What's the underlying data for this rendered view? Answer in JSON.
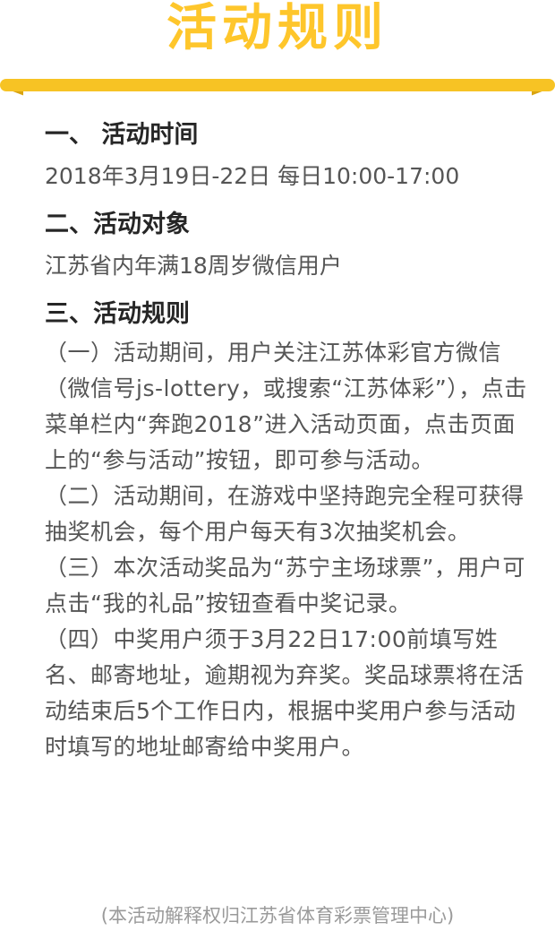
{
  "title": "活动规则",
  "sections": [
    {
      "heading": "一、  活动时间",
      "text": "2018年3月19日-22日 每日10:00-17:00"
    },
    {
      "heading": "二、活动对象",
      "text": "江苏省内年满18周岁微信用户"
    },
    {
      "heading": "三、活动规则"
    }
  ],
  "rules": [
    "（一）活动期间，用户关注江苏体彩官方微信（微信号js-lottery，或搜索“江苏体彩”），点击菜单栏内“奔跑2018”进入活动页面，点击页面上的“参与活动”按钮，即可参与活动。",
    "（二）活动期间，在游戏中坚持跑完全程可获得抽奖机会，每个用户每天有3次抽奖机会。",
    "（三）本次活动奖品为“苏宁主场球票”，用户可点击“我的礼品”按钮查看中奖记录。",
    "（四）中奖用户须于3月22日17:00前填写姓名、邮寄地址，逾期视为弃奖。奖品球票将在活动结束后5个工作日内，根据中奖用户参与活动时填写的地址邮寄给中奖用户。"
  ],
  "footer": "(本活动解释权归江苏省体育彩票管理中心)",
  "colors": {
    "accent": "#fec62b",
    "bar": "#f7c324",
    "text": "#555555"
  }
}
